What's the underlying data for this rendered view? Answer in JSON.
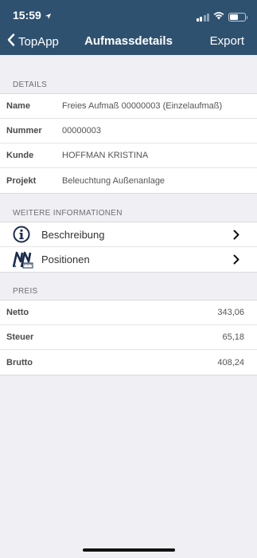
{
  "status_bar": {
    "time": "15:59"
  },
  "nav": {
    "back_label": "TopApp",
    "title": "Aufmassdetails",
    "action_label": "Export"
  },
  "details": {
    "header": "DETAILS",
    "rows": [
      {
        "label": "Name",
        "value": "Freies Aufmaß 00000003 (Einzelaufmaß)"
      },
      {
        "label": "Nummer",
        "value": "00000003"
      },
      {
        "label": "Kunde",
        "value": "HOFFMAN KRISTINA"
      },
      {
        "label": "Projekt",
        "value": "Beleuchtung Außenanlage"
      }
    ]
  },
  "more_info": {
    "header": "WEITERE INFORMATIONEN",
    "items": [
      {
        "label": "Beschreibung",
        "icon": "info-icon"
      },
      {
        "label": "Positionen",
        "icon": "measurement-icon"
      }
    ]
  },
  "price": {
    "header": "PREIS",
    "rows": [
      {
        "label": "Netto",
        "value": "343,06"
      },
      {
        "label": "Steuer",
        "value": "65,18"
      },
      {
        "label": "Brutto",
        "value": "408,24"
      }
    ]
  },
  "colors": {
    "nav_background": "#2f5170",
    "page_background": "#efeff4"
  }
}
